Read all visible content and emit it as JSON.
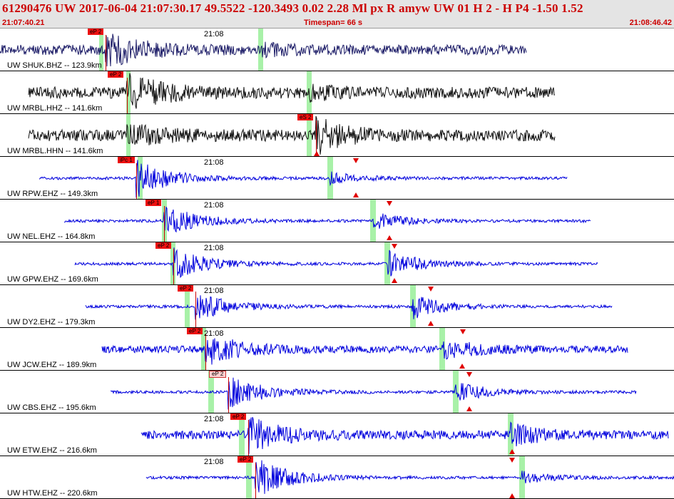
{
  "header": {
    "line1": "61290476 UW 2017-06-04 21:07:30.17    49.5522 -120.3493    0.02  2.28 Ml  px  R amyw     UW 01  H   2  -  H P4   -1.50  1.52",
    "start_time": "21:07:40.21",
    "timespan": "Timespan=  66 s",
    "end_time": "21:08:46.42"
  },
  "time_marker_label": "21:08",
  "colors": {
    "header_bg": "#e4e4e4",
    "header_text": "#cc0000",
    "pick": "#ee1111",
    "green_window": "#99ee99",
    "trace_navy": "#1a1a66",
    "trace_black": "#111111",
    "trace_blue": "#0000dd"
  },
  "traces": [
    {
      "label": "UW SHUK.BHZ -- 123.9km",
      "pick_label": "eP 2",
      "color": "navy"
    },
    {
      "label": "UW MRBL.HHZ -- 141.6km",
      "pick_label": "eP 2",
      "color": "black"
    },
    {
      "label": "UW MRBL.HHN -- 141.6km",
      "pick_label": "eS 2",
      "color": "black"
    },
    {
      "label": "UW RPW.EHZ -- 149.3km",
      "pick_label": "iPc 1",
      "color": "blue"
    },
    {
      "label": "UW NEL.EHZ -- 164.8km",
      "pick_label": "eP 1",
      "color": "blue"
    },
    {
      "label": "UW GPW.EHZ -- 169.6km",
      "pick_label": "eP 2",
      "color": "blue"
    },
    {
      "label": "UW DY2.EHZ -- 179.3km",
      "pick_label": "eP 2",
      "color": "blue"
    },
    {
      "label": "UW JCW.EHZ -- 189.9km",
      "pick_label": "eP 2",
      "color": "blue"
    },
    {
      "label": "UW CBS.EHZ -- 195.6km",
      "pick_label": "eP 2",
      "color": "blue"
    },
    {
      "label": "UW ETW.EHZ -- 216.6km",
      "pick_label": "eP 2",
      "color": "blue"
    },
    {
      "label": "UW HTW.EHZ -- 220.6km",
      "pick_label": "eP 2",
      "color": "blue"
    }
  ]
}
